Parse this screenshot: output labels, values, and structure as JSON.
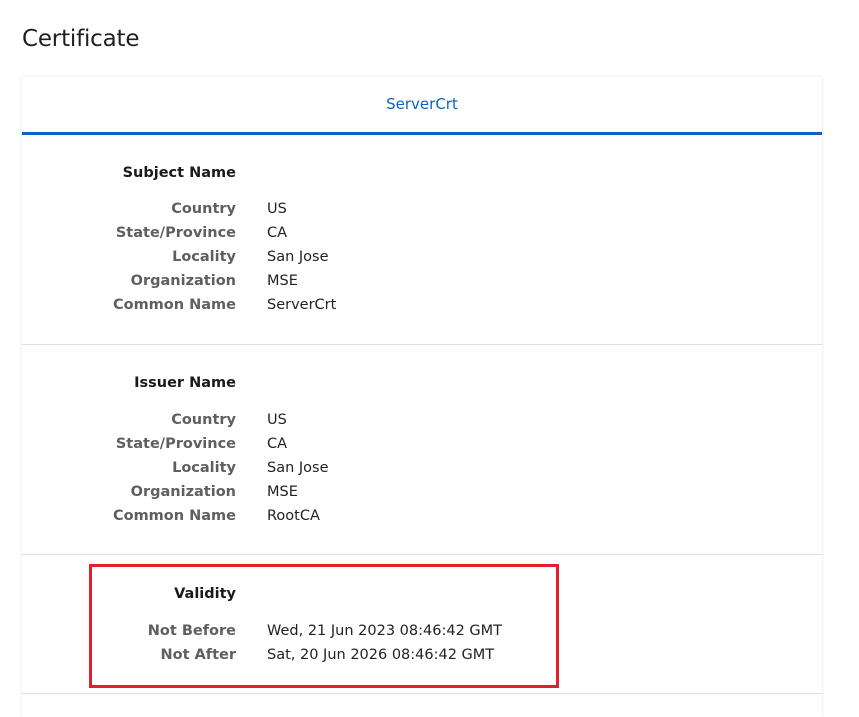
{
  "page": {
    "title": "Certificate"
  },
  "tabs": [
    {
      "label": "ServerCrt",
      "active": true
    }
  ],
  "accent_color": "#0b62c4",
  "highlight_color": "#e0202c",
  "subject": {
    "heading": "Subject Name",
    "fields": [
      {
        "label": "Country",
        "value": "US"
      },
      {
        "label": "State/Province",
        "value": "CA"
      },
      {
        "label": "Locality",
        "value": "San Jose"
      },
      {
        "label": "Organization",
        "value": "MSE"
      },
      {
        "label": "Common Name",
        "value": "ServerCrt"
      }
    ]
  },
  "issuer": {
    "heading": "Issuer Name",
    "fields": [
      {
        "label": "Country",
        "value": "US"
      },
      {
        "label": "State/Province",
        "value": "CA"
      },
      {
        "label": "Locality",
        "value": "San Jose"
      },
      {
        "label": "Organization",
        "value": "MSE"
      },
      {
        "label": "Common Name",
        "value": "RootCA"
      }
    ]
  },
  "validity": {
    "heading": "Validity",
    "fields": [
      {
        "label": "Not Before",
        "value": "Wed, 21 Jun 2023 08:46:42 GMT"
      },
      {
        "label": "Not After",
        "value": "Sat, 20 Jun 2026 08:46:42 GMT"
      }
    ]
  }
}
